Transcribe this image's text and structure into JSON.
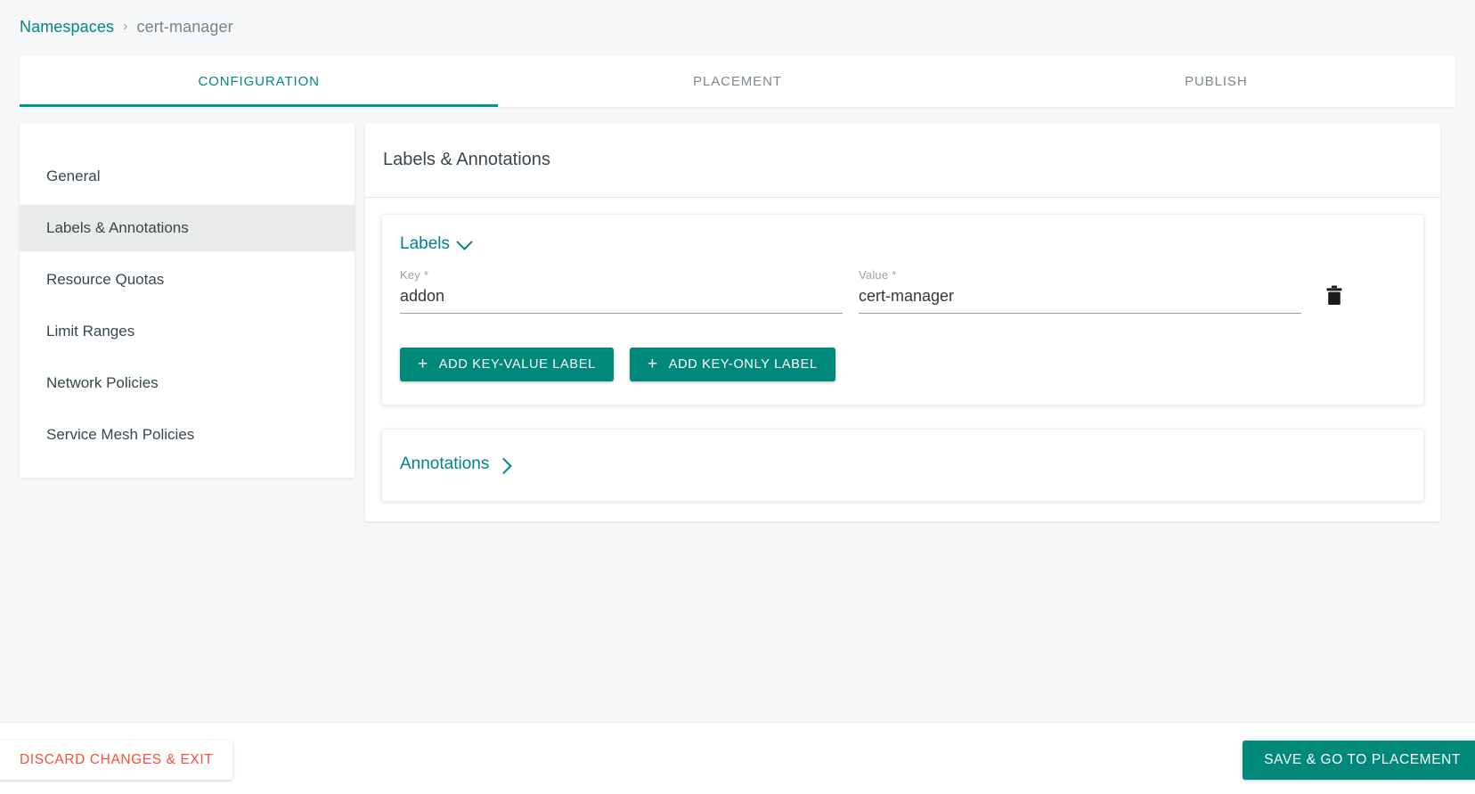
{
  "breadcrumb": {
    "root_label": "Namespaces",
    "separator": "›",
    "current_label": "cert-manager"
  },
  "tabs": [
    {
      "label": "CONFIGURATION",
      "active": true
    },
    {
      "label": "PLACEMENT",
      "active": false
    },
    {
      "label": "PUBLISH",
      "active": false
    }
  ],
  "sidebar": {
    "items": [
      {
        "label": "General",
        "active": false
      },
      {
        "label": "Labels & Annotations",
        "active": true
      },
      {
        "label": "Resource Quotas",
        "active": false
      },
      {
        "label": "Limit Ranges",
        "active": false
      },
      {
        "label": "Network Policies",
        "active": false
      },
      {
        "label": "Service Mesh Policies",
        "active": false
      }
    ]
  },
  "main": {
    "title": "Labels & Annotations",
    "labels_section": {
      "title": "Labels",
      "expanded": true,
      "chevron_icon": "chevron-down-icon",
      "rows": [
        {
          "key_label": "Key *",
          "key_value": "addon",
          "key_placeholder": "",
          "value_label": "Value *",
          "value_value": "cert-manager",
          "value_placeholder": "",
          "delete_icon": "trash-icon"
        }
      ],
      "add_key_value_label": "ADD KEY-VALUE LABEL",
      "add_key_only_label": "ADD KEY-ONLY LABEL",
      "plus_icon": "+"
    },
    "annotations_section": {
      "title": "Annotations",
      "expanded": false,
      "chevron_icon": "chevron-right-icon"
    }
  },
  "footer": {
    "discard_label": "DISCARD CHANGES & EXIT",
    "save_label": "SAVE & GO TO PLACEMENT"
  },
  "colors": {
    "accent_teal": "#00897b",
    "tab_underline": "#009688",
    "link_teal": "#00838f",
    "danger_red": "#f4503c",
    "page_bg": "#f5f7f9",
    "active_side_bg": "#e9eaea"
  }
}
